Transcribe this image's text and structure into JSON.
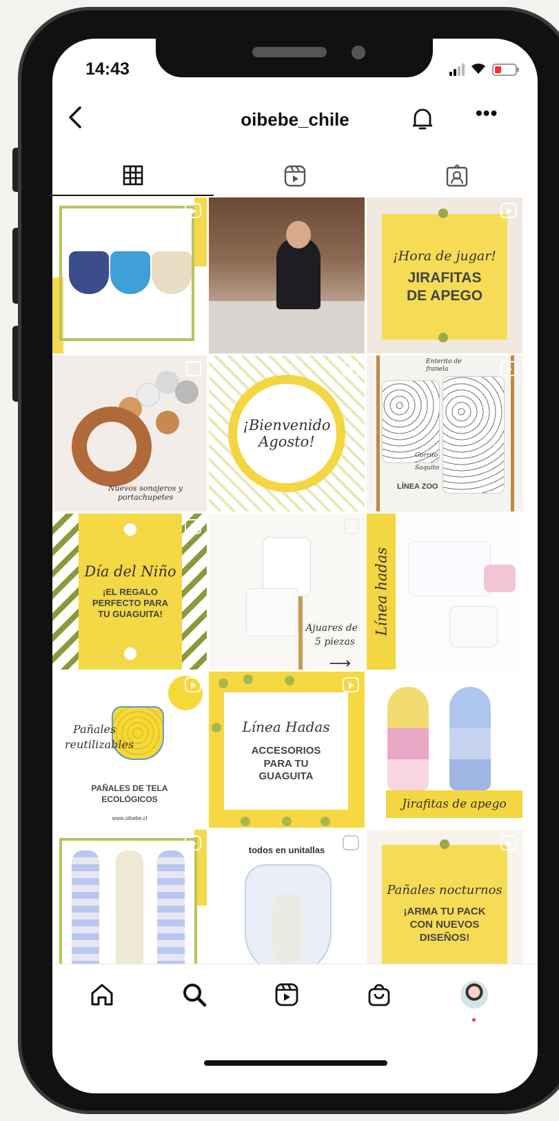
{
  "status_bar": {
    "time": "14:43"
  },
  "header": {
    "username": "oibebe_chile"
  },
  "tabs": [
    {
      "name": "grid",
      "active": true
    },
    {
      "name": "reels",
      "active": false
    },
    {
      "name": "tagged",
      "active": false
    }
  ],
  "posts": [
    {
      "id": "diapers",
      "texts": []
    },
    {
      "id": "store",
      "texts": []
    },
    {
      "id": "jirafitas",
      "texts": [
        "¡Hora de jugar!",
        "JIRAFITAS",
        "DE APEGO"
      ]
    },
    {
      "id": "sonajeros",
      "texts": [
        "Nuevos sonajeros y portachupetes"
      ]
    },
    {
      "id": "agosto",
      "texts": [
        "¡Bienvenido",
        "Agosto!"
      ]
    },
    {
      "id": "zoo",
      "texts": [
        "Enterito de",
        "franela",
        "Gorrito",
        "Saquito",
        "LÍNEA ZOO"
      ]
    },
    {
      "id": "nino",
      "texts": [
        "Día del Niño",
        "¡EL REGALO",
        "PERFECTO PARA",
        "TU GUAGUITA!"
      ]
    },
    {
      "id": "ajuares",
      "texts": [
        "Ajuares de",
        "5 piezas"
      ]
    },
    {
      "id": "hadas1",
      "texts": [
        "Línea hadas"
      ]
    },
    {
      "id": "panales",
      "texts": [
        "Pañales",
        "reutilizables",
        "PAÑALES DE TELA",
        "ECOLÓGICOS",
        "www.oibebe.cl"
      ]
    },
    {
      "id": "hadas2",
      "texts": [
        "Línea Hadas",
        "ACCESORIOS",
        "PARA TU",
        "GUAGUITA"
      ]
    },
    {
      "id": "jirafitas2",
      "texts": [
        "Jirafitas de apego"
      ]
    },
    {
      "id": "legs",
      "texts": []
    },
    {
      "id": "unitallas",
      "texts": [
        "todos en unitallas"
      ]
    },
    {
      "id": "nocturnos",
      "texts": [
        "Pañales nocturnos",
        "¡ARMA TU PACK",
        "CON NUEVOS",
        "DISEÑOS!"
      ]
    }
  ],
  "bottom_nav": [
    "home-icon",
    "search-icon",
    "reels-icon",
    "shop-icon",
    "profile-avatar"
  ],
  "colors": {
    "accent_yellow": "#f4d845",
    "olive": "#b9c35c",
    "text": "#111111"
  }
}
